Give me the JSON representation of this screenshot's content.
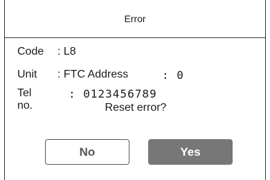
{
  "dialog": {
    "title": "Error",
    "code_label": "Code",
    "code_value": ": L8",
    "unit_label": "Unit",
    "unit_value": ": FTC Address",
    "unit_address_value": ": 0",
    "tel_label": "Tel no.",
    "tel_value": ": 0123456789",
    "prompt": "Reset error?",
    "no_label": "No",
    "yes_label": "Yes"
  },
  "colors": {
    "yes_button_bg": "#777777",
    "border": "#333333"
  }
}
